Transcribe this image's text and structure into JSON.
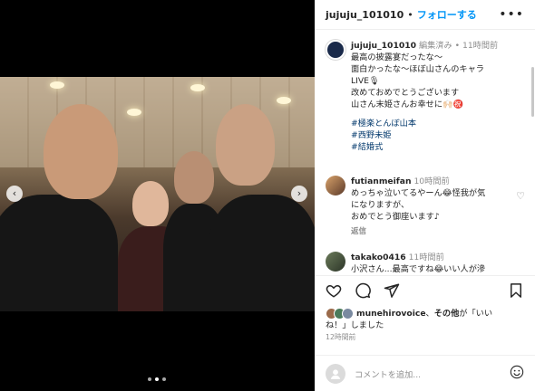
{
  "header": {
    "username": "jujuju_101010",
    "separator": "•",
    "follow_label": "フォローする",
    "more_icon": "more-dots-icon"
  },
  "caption": {
    "username": "jujuju_101010",
    "edited": "編集済み",
    "dot": "•",
    "time": "11時間前",
    "lines": [
      "最高の披露宴だったな〜",
      "面白かったな〜ほぼ山さんのキャラ",
      "LIVE🎙",
      "改めておめでとうございます",
      "山さん末姫さんお幸せに🙌🏻㊗️"
    ],
    "hashtags": [
      "#極楽とんぼ山本",
      "#西野未姫",
      "#結婚式"
    ]
  },
  "comments": [
    {
      "username": "futianmeifan",
      "time": "10時間前",
      "lines": [
        "めっちゃ泣いてるやーん😂怪我が気",
        "になりますが、",
        "おめでとう御座います♪"
      ],
      "reply": "返信"
    },
    {
      "username": "takako0416",
      "time": "11時間前",
      "lines": [
        "小沢さん...最高ですね😂いい人が滲"
      ]
    }
  ],
  "likes": {
    "user": "munehirovoice",
    "mid": "、",
    "others": "その他",
    "tail": "が「いい",
    "tail2": "ね！」しました"
  },
  "post_time": "12時間前",
  "add_comment": {
    "placeholder": "コメントを追加..."
  },
  "carousel": {
    "prev": "‹",
    "next": "›",
    "index": 2,
    "count": 3
  },
  "colors": {
    "accent": "#0095f6",
    "hashtag": "#00376b",
    "muted": "#8e8e8e"
  }
}
